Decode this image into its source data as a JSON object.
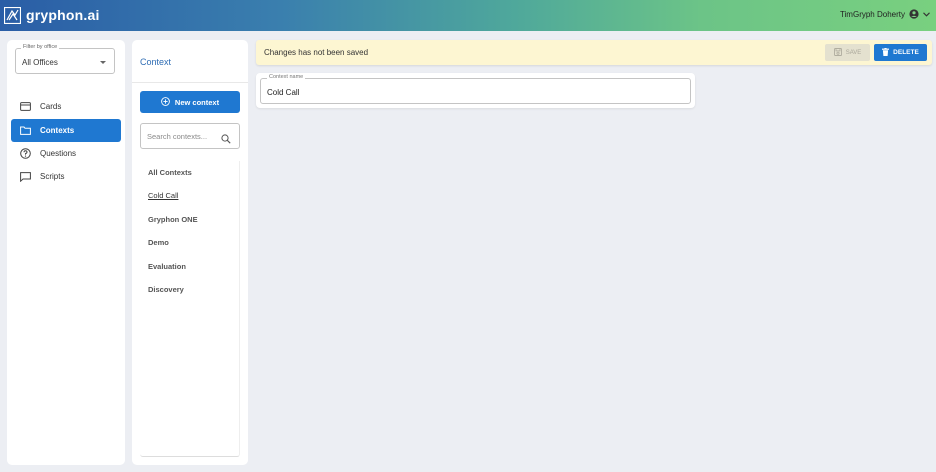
{
  "header": {
    "brand": "gryphon.ai",
    "user_name": "TimGryph Doherty"
  },
  "sidebar": {
    "filter_label": "Filter by office",
    "filter_value": "All Offices",
    "items": [
      {
        "label": "Cards",
        "icon": "card-icon",
        "active": false
      },
      {
        "label": "Contexts",
        "icon": "folder-icon",
        "active": true
      },
      {
        "label": "Questions",
        "icon": "help-circle-icon",
        "active": false
      },
      {
        "label": "Scripts",
        "icon": "chat-bubble-icon",
        "active": false
      }
    ]
  },
  "context_panel": {
    "title": "Context",
    "new_button": "New context",
    "search_placeholder": "Search contexts...",
    "items": [
      "All Contexts",
      "Cold Call",
      "Gryphon ONE",
      "Demo",
      "Evaluation",
      "Discovery"
    ],
    "selected": "Cold Call"
  },
  "banner": {
    "message": "Changes has not been saved",
    "save_label": "SAVE",
    "delete_label": "DELETE"
  },
  "editor": {
    "field_label": "Context name",
    "field_value": "Cold Call"
  },
  "colors": {
    "accent": "#1f78d1",
    "banner_bg": "#fdf6d2",
    "page_bg": "#eceef3"
  }
}
